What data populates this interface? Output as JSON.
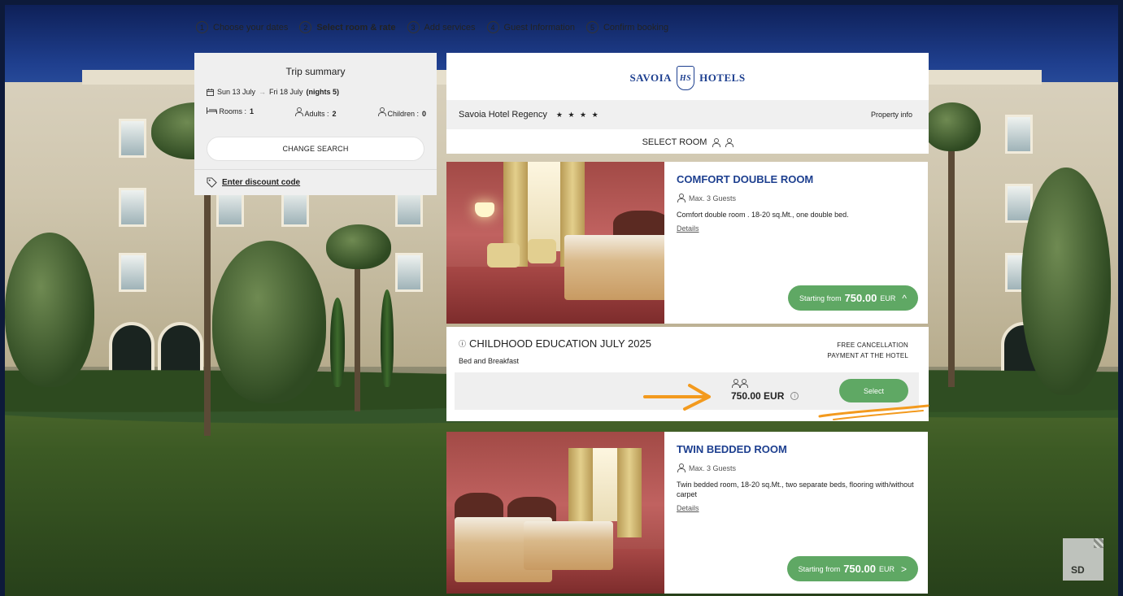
{
  "steps": [
    {
      "num": "1",
      "label": "Choose your dates"
    },
    {
      "num": "2",
      "label": "Select room & rate"
    },
    {
      "num": "3",
      "label": "Add services"
    },
    {
      "num": "4",
      "label": "Guest Information"
    },
    {
      "num": "5",
      "label": "Confirm booking"
    }
  ],
  "summary": {
    "title": "Trip summary",
    "checkin": "Sun 13 July",
    "checkout": "Fri 18 July",
    "nights": "(nights 5)",
    "rooms_label": "Rooms :",
    "rooms_value": "1",
    "adults_label": "Adults :",
    "adults_value": "2",
    "children_label": "Children :",
    "children_value": "0",
    "change_label": "CHANGE SEARCH",
    "discount_label": "Enter discount code"
  },
  "hotel": {
    "logo_left": "SAVOIA",
    "logo_mark": "HS",
    "logo_right": "HOTELS",
    "name": "Savoia Hotel Regency",
    "stars": "★ ★ ★ ★",
    "property_info": "Property info",
    "select_room": "SELECT ROOM"
  },
  "rooms": [
    {
      "name": "COMFORT DOUBLE ROOM",
      "guests": "Max. 3 Guests",
      "desc": "Comfort double room . 18-20 sq.Mt., one double bed.",
      "details": "Details",
      "price_prefix": "Starting from",
      "price": "750.00",
      "currency": "EUR",
      "chevron": "^"
    },
    {
      "name": "TWIN BEDDED ROOM",
      "guests": "Max. 3 Guests",
      "desc": "Twin bedded room, 18-20 sq.Mt., two separate beds, flooring with/without carpet",
      "details": "Details",
      "price_prefix": "Starting from",
      "price": "750.00",
      "currency": "EUR",
      "chevron": ">"
    }
  ],
  "rate": {
    "name": "CHILDHOOD EDUCATION JULY 2025",
    "board": "Bed and Breakfast",
    "policy_1": "FREE CANCELLATION",
    "policy_2": "PAYMENT AT THE HOTEL",
    "price": "750.00 EUR",
    "select_label": "Select"
  },
  "watermark": "SD",
  "colors": {
    "accent_green": "#5fa864",
    "brand_blue": "#1d3f8f",
    "arrow_orange": "#f39a1e"
  }
}
